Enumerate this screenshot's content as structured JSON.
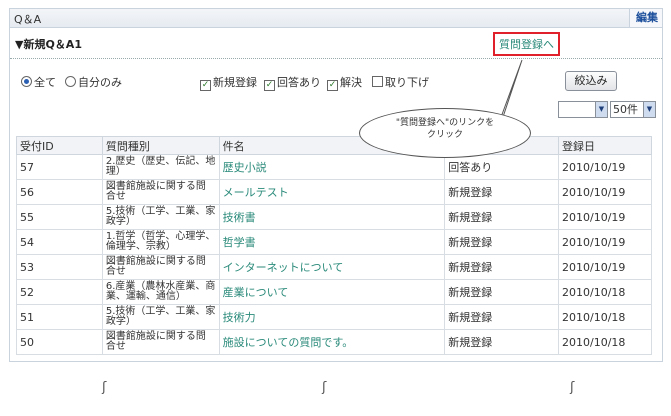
{
  "panel": {
    "title": "Q＆A",
    "edit_label": "編集"
  },
  "section": {
    "title": "▼新規Q＆A1",
    "register_link": "質問登録へ"
  },
  "filters": {
    "radio_all": "全て",
    "radio_mine": "自分のみ",
    "check_new": "新規登録",
    "check_answered": "回答あり",
    "check_resolved": "解決",
    "check_withdrawn": "取り下げ",
    "filter_button": "絞込み",
    "page_size": "50件"
  },
  "callout": {
    "line1": "\"質問登録へ\"のリンクを",
    "line2": "クリック"
  },
  "table": {
    "headers": [
      "受付ID",
      "質問種別",
      "件名",
      "",
      "登録日"
    ],
    "rows": [
      {
        "id": "57",
        "category": "2.歴史（歴史、伝記、地理）",
        "subject": "歴史小説",
        "status": "回答あり",
        "date": "2010/10/19"
      },
      {
        "id": "56",
        "category": "図書館施設に関する問合せ",
        "subject": "メールテスト",
        "status": "新規登録",
        "date": "2010/10/19"
      },
      {
        "id": "55",
        "category": "5.技術（工学、工業、家政学）",
        "subject": "技術書",
        "status": "新規登録",
        "date": "2010/10/19"
      },
      {
        "id": "54",
        "category": "1.哲学（哲学、心理学、倫理学、宗教）",
        "subject": "哲学書",
        "status": "新規登録",
        "date": "2010/10/19"
      },
      {
        "id": "53",
        "category": "図書館施設に関する問合せ",
        "subject": "インターネットについて",
        "status": "新規登録",
        "date": "2010/10/19"
      },
      {
        "id": "52",
        "category": "6.産業（農林水産業、商業、運輸、通信）",
        "subject": "産業について",
        "status": "新規登録",
        "date": "2010/10/18"
      },
      {
        "id": "51",
        "category": "5.技術（工学、工業、家政学）",
        "subject": "技術力",
        "status": "新規登録",
        "date": "2010/10/18"
      },
      {
        "id": "50",
        "category": "図書館施設に関する問合せ",
        "subject": "施設についての質問です。",
        "status": "新規登録",
        "date": "2010/10/18"
      }
    ]
  },
  "colors": {
    "link": "#2a8a7a",
    "highlight": "#e0202a",
    "edit": "#1d4f9c"
  }
}
